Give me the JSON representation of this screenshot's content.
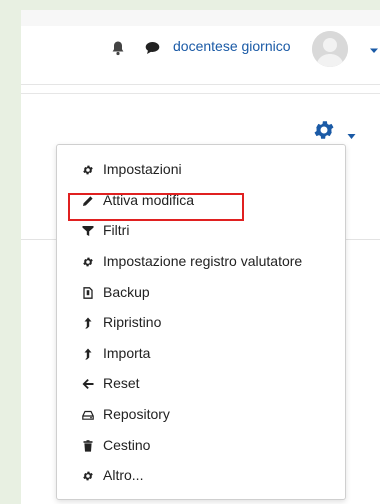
{
  "header": {
    "username": "docentese giornico",
    "icons": [
      "bell-icon",
      "chat-icon",
      "chevron-down-icon"
    ]
  },
  "actions": {
    "gear_icon": "gear-icon",
    "caret_icon": "chevron-down-icon"
  },
  "menu": {
    "items": [
      {
        "label": "Impostazioni",
        "icon": "gear-icon"
      },
      {
        "label": "Attiva modifica",
        "icon": "pencil-icon"
      },
      {
        "label": "Filtri",
        "icon": "filter-icon"
      },
      {
        "label": "Impostazione registro valutatore",
        "icon": "gear-icon"
      },
      {
        "label": "Backup",
        "icon": "file-icon"
      },
      {
        "label": "Ripristino",
        "icon": "upload-arrow-icon"
      },
      {
        "label": "Importa",
        "icon": "upload-arrow-icon"
      },
      {
        "label": "Reset",
        "icon": "arrow-left-icon"
      },
      {
        "label": "Repository",
        "icon": "hard-drive-icon"
      },
      {
        "label": "Cestino",
        "icon": "trash-icon"
      },
      {
        "label": "Altro...",
        "icon": "gear-icon"
      }
    ],
    "highlighted_item": "Attiva modifica"
  },
  "colors": {
    "accent": "#1a5aa6",
    "highlight": "#e02020",
    "frame": "#e8f0e2"
  }
}
